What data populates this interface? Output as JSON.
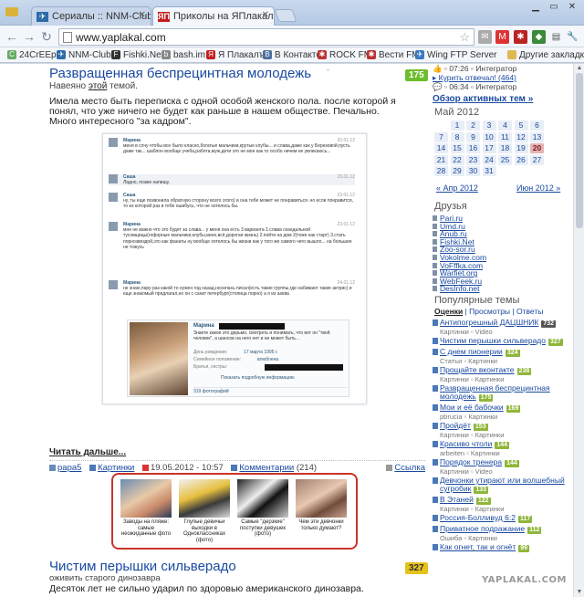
{
  "colors": {
    "accent": "#1a4aa0",
    "score_green": "#6cbd2d",
    "score_yellow": "#e5c21b",
    "related_border": "#c9342a"
  },
  "browser": {
    "tabs": [
      {
        "label": "Сериалы :: NNM-Club.ru",
        "icon": "nnm-icon"
      },
      {
        "label": "Приколы на ЯПлакалъ",
        "icon": "yaplakal-icon"
      }
    ],
    "url": "www.yaplakal.com",
    "bookmarks": [
      {
        "label": "24CrEEp",
        "icon": "c-icon"
      },
      {
        "label": "NNM-Club",
        "icon": "nnm-icon"
      },
      {
        "label": "Fishki.Net",
        "icon": "fishki-icon"
      },
      {
        "label": "bash.im",
        "icon": "bash-icon"
      },
      {
        "label": "Я Плакалъ",
        "icon": "yaplakal-icon"
      },
      {
        "label": "В Контакте",
        "icon": "vk-icon"
      },
      {
        "label": "ROCK FM",
        "icon": "rockfm-icon"
      },
      {
        "label": "Вести FM",
        "icon": "vesti-icon"
      },
      {
        "label": "Wing FTP Server",
        "icon": "wing-icon"
      },
      {
        "label": "Другие закладки",
        "icon": "folder-icon"
      }
    ]
  },
  "post": {
    "title": "Развращенная беспрецинтная молодежь",
    "score": "175",
    "author_prefix": "Навеяно ",
    "author_link": "этой",
    "author_suffix": " темой.",
    "text": "Имела место быть переписка с одной особой женского пола. после которой я понял, что уже ничего не будет как раньше в нашем обществе. Печально.",
    "text2": "Много интересного \"за кадром\".",
    "readmore": "Читать дальше...",
    "meta": {
      "author": "papa5",
      "category": "Картинки",
      "date": "19.05.2012 - 10:57",
      "comments": "Комментарии",
      "comments_count": "(214)",
      "link": "Ссылка"
    }
  },
  "chat": {
    "messages": [
      {
        "who": "Марина",
        "date": "20.01.12",
        "text": "меня в сочу чтобы все было класно,богатые мальчики,крутые клубы... и слава,даже как у Березовой,пусть даже так... шаблон вообще учеба,работа,муж,дети это не мое как то особо ничем не увлекаюсь..."
      },
      {
        "who": "Саша",
        "date": "23.01.12",
        "text": "Ладно, позже напишу."
      },
      {
        "who": "Саша",
        "date": "23.01.12",
        "text": "ну, ты еще позвонила обратную сторону всего этого) и она тебе может не понравиться. но если понравится, то из которой раз в тебе ошибусь, что не хотелось бы."
      },
      {
        "who": "Марина",
        "date": "23.01.12",
        "text": "мне не важно что это будет за слава... у меня она есть 3 варианта 1.слава скандальной тусовщицы(гофорные мальчики,клубы,вино,всё,дорогая жизнь) 2.пойти на дом 2(тоже как старт) 3.стать порнозвездой,это как фанаты ну вообще хотелось бы жизни как у того же самого чего вышло... на большее не тожусь"
      },
      {
        "who": "Марина",
        "date": "24.01.12",
        "text": "не знаю,пару раз какой то нужен год назад,носилась писал(есть такие группы,где набивают такие актрис) и еще знакомый предлагал,но он с санкт петербург(столица порно) а я из азова"
      }
    ],
    "profile": {
      "name": "Марина",
      "quote": "Знаете какое это дерьмо, смотреть и понимать, что вот он \"твой человек\", а шансов на него нет и не может быть...",
      "rows": [
        {
          "label": "День рождения:",
          "value": "17 марта 1995 г."
        },
        {
          "label": "Семейное положение:",
          "value": "влюблена"
        },
        {
          "label": "Братья, сестры:",
          "value": ""
        }
      ],
      "more": "Показать подробную информацию",
      "photos": "319 фотографий"
    }
  },
  "related": [
    {
      "caption": "Заводы на пляже: самые неожиданные фото"
    },
    {
      "caption": "Глупые девичьи выходки в Одноклассниках (фото)"
    },
    {
      "caption": "Самые \"дерзкие\" поступки девушек (фото)"
    },
    {
      "caption": "Чем эти девчонки только думают?"
    }
  ],
  "post2": {
    "title": "Чистим перышки сильверадо",
    "score": "327",
    "sub": "оживить старого динозавра",
    "text": "Десяток лет не сильно ударил по здоровью американского динозавра."
  },
  "sidebar": {
    "top_items": [
      {
        "text": "👍 ▫ 07:26 ▫ Интегратор"
      },
      {
        "text": "▸ Курить отвечал! (464)"
      },
      {
        "text": "💬 ▫ 06:34 ▫ Интегратор"
      }
    ],
    "active_link": "Обзор активных тем »",
    "calendar": {
      "title": "Май 2012",
      "days": [
        "1",
        "2",
        "3",
        "4",
        "5",
        "6",
        "7",
        "8",
        "9",
        "10",
        "11",
        "12",
        "13",
        "14",
        "15",
        "16",
        "17",
        "18",
        "19",
        "20",
        "21",
        "22",
        "23",
        "24",
        "25",
        "26",
        "27",
        "28",
        "29",
        "30",
        "31"
      ],
      "today": "20",
      "prev": "« Апр 2012",
      "next": "Июн 2012 »"
    },
    "friends_title": "Друзья",
    "friends": [
      "Pari.ru",
      "Umd.ru",
      "Anub.ru",
      "Fishki.Net",
      "Zoo-sor.ru",
      "Vokolme.com",
      "VoFffka.com",
      "Warfiet.org",
      "WebFeek.ru",
      "DesInfo.net"
    ],
    "popular_title": "Популярные темы",
    "popular_tabs": {
      "active": "Оценки",
      "others": " | Просмотры | Ответы"
    },
    "topics": [
      {
        "title": "Антипогрешный ДАЦШНИК",
        "count": "732",
        "sub": "Картинки ▫ Video"
      },
      {
        "title": "Чистим перышки сильверадо",
        "count": "327",
        "sub": ""
      },
      {
        "title": "С днем пионерии",
        "count": "324",
        "sub": "Статьи ▫ Картинки"
      },
      {
        "title": "Прощайте вконтакте",
        "count": "238",
        "sub": "Картинки ▫ Картинки"
      },
      {
        "title": "Развращенная беспрецинтная молодежь",
        "count": "175",
        "sub": ""
      },
      {
        "title": "Мои и её бабочки",
        "count": "169",
        "sub": "pbrucia ▫ Картинки"
      },
      {
        "title": "Пройдёт",
        "count": "153",
        "sub": "Картинки ▫ Картинки"
      },
      {
        "title": "Красиво чтоли",
        "count": "144",
        "sub": "arbeiten ▫ Картинки"
      },
      {
        "title": "Порядок тренера",
        "count": "144",
        "sub": "Картинки ▫ Video"
      },
      {
        "title": "Девчонки утирают или волшебный сугробик",
        "count": "133",
        "sub": ""
      },
      {
        "title": "В Этаней",
        "count": "122",
        "sub": "Картинки ▫ Картинки"
      },
      {
        "title": "Россия-Болливуд 6:2",
        "count": "117",
        "sub": ""
      },
      {
        "title": "Приватное подражание",
        "count": "112",
        "sub": "Ошиба ▫ Картинки"
      },
      {
        "title": "Как огнет, так и огнёт",
        "count": "99",
        "sub": ""
      }
    ]
  },
  "watermark": "YAPLAKAL.COM"
}
